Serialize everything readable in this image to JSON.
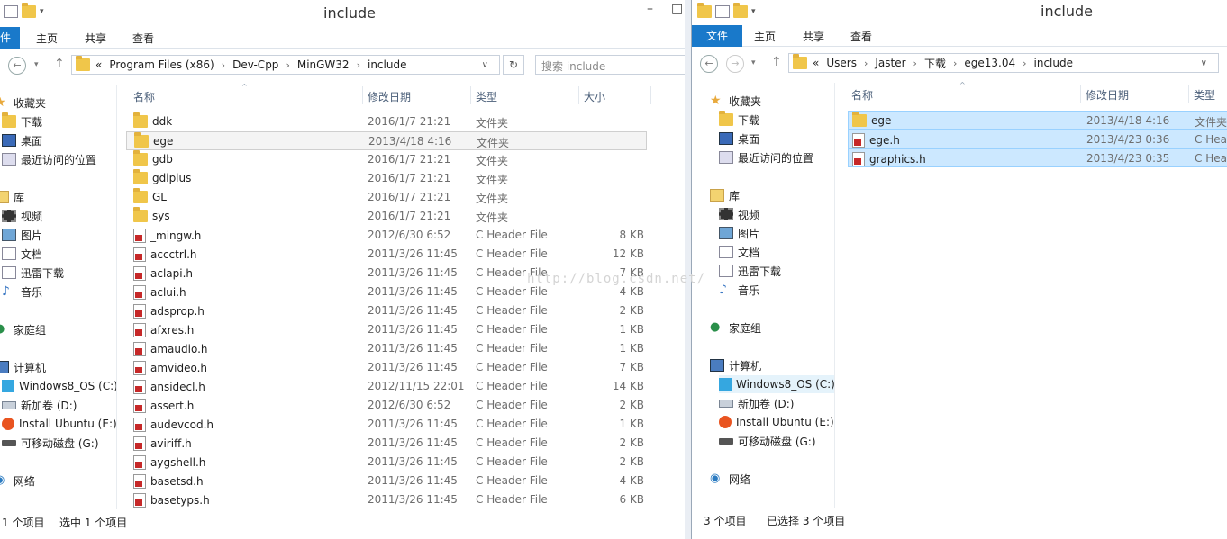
{
  "left": {
    "title": "include",
    "ribbon_tabs": [
      "件",
      "主页",
      "共享",
      "查看"
    ],
    "address": {
      "prefix": "«",
      "segments": [
        "Program Files (x86)",
        "Dev-Cpp",
        "MinGW32",
        "include"
      ]
    },
    "search_placeholder": "搜索 include",
    "nav": [
      {
        "label": "收藏夹",
        "icon": "favorites-star-icon",
        "icls": "star"
      },
      {
        "label": "下载",
        "icon": "downloads-folder-icon",
        "icls": "folder"
      },
      {
        "label": "桌面",
        "icon": "desktop-icon",
        "icls": "desk"
      },
      {
        "label": "最近访问的位置",
        "icon": "recent-places-icon",
        "icls": "recent"
      },
      {
        "label": "库",
        "icon": "libraries-icon",
        "icls": "lib"
      },
      {
        "label": "视频",
        "icon": "videos-icon",
        "icls": "video"
      },
      {
        "label": "图片",
        "icon": "pictures-icon",
        "icls": "pic"
      },
      {
        "label": "文档",
        "icon": "documents-icon",
        "icls": "doc"
      },
      {
        "label": "迅雷下载",
        "icon": "thunder-download-icon",
        "icls": "doc"
      },
      {
        "label": "音乐",
        "icon": "music-icon",
        "icls": "music"
      },
      {
        "label": "家庭组",
        "icon": "homegroup-icon",
        "icls": "home"
      },
      {
        "label": "计算机",
        "icon": "computer-icon",
        "icls": "pc"
      },
      {
        "label": "Windows8_OS (C:)",
        "icon": "windows-drive-icon",
        "icls": "win8"
      },
      {
        "label": "新加卷 (D:)",
        "icon": "drive-icon",
        "icls": "drv"
      },
      {
        "label": "Install Ubuntu (E:)",
        "icon": "ubuntu-drive-icon",
        "icls": "ubuntu"
      },
      {
        "label": "可移动磁盘 (G:)",
        "icon": "removable-drive-icon",
        "icls": "usb"
      },
      {
        "label": "网络",
        "icon": "network-icon",
        "icls": "net"
      }
    ],
    "columns": {
      "name": "名称",
      "date": "修改日期",
      "type": "类型",
      "size": "大小"
    },
    "files": [
      {
        "name": "ddk",
        "date": "2016/1/7 21:21",
        "type": "文件夹",
        "size": "",
        "kind": "folder"
      },
      {
        "name": "ege",
        "date": "2013/4/18 4:16",
        "type": "文件夹",
        "size": "",
        "kind": "folder"
      },
      {
        "name": "gdb",
        "date": "2016/1/7 21:21",
        "type": "文件夹",
        "size": "",
        "kind": "folder"
      },
      {
        "name": "gdiplus",
        "date": "2016/1/7 21:21",
        "type": "文件夹",
        "size": "",
        "kind": "folder"
      },
      {
        "name": "GL",
        "date": "2016/1/7 21:21",
        "type": "文件夹",
        "size": "",
        "kind": "folder"
      },
      {
        "name": "sys",
        "date": "2016/1/7 21:21",
        "type": "文件夹",
        "size": "",
        "kind": "folder"
      },
      {
        "name": "_mingw.h",
        "date": "2012/6/30 6:52",
        "type": "C Header File",
        "size": "8 KB",
        "kind": "hfile"
      },
      {
        "name": "accctrl.h",
        "date": "2011/3/26 11:45",
        "type": "C Header File",
        "size": "12 KB",
        "kind": "hfile"
      },
      {
        "name": "aclapi.h",
        "date": "2011/3/26 11:45",
        "type": "C Header File",
        "size": "7 KB",
        "kind": "hfile"
      },
      {
        "name": "aclui.h",
        "date": "2011/3/26 11:45",
        "type": "C Header File",
        "size": "4 KB",
        "kind": "hfile"
      },
      {
        "name": "adsprop.h",
        "date": "2011/3/26 11:45",
        "type": "C Header File",
        "size": "2 KB",
        "kind": "hfile"
      },
      {
        "name": "afxres.h",
        "date": "2011/3/26 11:45",
        "type": "C Header File",
        "size": "1 KB",
        "kind": "hfile"
      },
      {
        "name": "amaudio.h",
        "date": "2011/3/26 11:45",
        "type": "C Header File",
        "size": "1 KB",
        "kind": "hfile"
      },
      {
        "name": "amvideo.h",
        "date": "2011/3/26 11:45",
        "type": "C Header File",
        "size": "7 KB",
        "kind": "hfile"
      },
      {
        "name": "ansidecl.h",
        "date": "2012/11/15 22:01",
        "type": "C Header File",
        "size": "14 KB",
        "kind": "hfile"
      },
      {
        "name": "assert.h",
        "date": "2012/6/30 6:52",
        "type": "C Header File",
        "size": "2 KB",
        "kind": "hfile"
      },
      {
        "name": "audevcod.h",
        "date": "2011/3/26 11:45",
        "type": "C Header File",
        "size": "1 KB",
        "kind": "hfile"
      },
      {
        "name": "aviriff.h",
        "date": "2011/3/26 11:45",
        "type": "C Header File",
        "size": "2 KB",
        "kind": "hfile"
      },
      {
        "name": "aygshell.h",
        "date": "2011/3/26 11:45",
        "type": "C Header File",
        "size": "2 KB",
        "kind": "hfile"
      },
      {
        "name": "basetsd.h",
        "date": "2011/3/26 11:45",
        "type": "C Header File",
        "size": "4 KB",
        "kind": "hfile"
      },
      {
        "name": "basetyps.h",
        "date": "2011/3/26 11:45",
        "type": "C Header File",
        "size": "6 KB",
        "kind": "hfile"
      }
    ],
    "selected_index": 1,
    "status": {
      "count": "1 个项目",
      "selected": "选中 1 个项目"
    }
  },
  "right": {
    "title": "include",
    "ribbon_tabs": [
      "文件",
      "主页",
      "共享",
      "查看"
    ],
    "address": {
      "prefix": "«",
      "segments": [
        "Users",
        "Jaster",
        "下载",
        "ege13.04",
        "include"
      ]
    },
    "nav": [
      {
        "label": "收藏夹",
        "icon": "favorites-star-icon",
        "icls": "star"
      },
      {
        "label": "下载",
        "icon": "downloads-folder-icon",
        "icls": "folder"
      },
      {
        "label": "桌面",
        "icon": "desktop-icon",
        "icls": "desk"
      },
      {
        "label": "最近访问的位置",
        "icon": "recent-places-icon",
        "icls": "recent"
      },
      {
        "label": "库",
        "icon": "libraries-icon",
        "icls": "lib"
      },
      {
        "label": "视频",
        "icon": "videos-icon",
        "icls": "video"
      },
      {
        "label": "图片",
        "icon": "pictures-icon",
        "icls": "pic"
      },
      {
        "label": "文档",
        "icon": "documents-icon",
        "icls": "doc"
      },
      {
        "label": "迅雷下载",
        "icon": "thunder-download-icon",
        "icls": "doc"
      },
      {
        "label": "音乐",
        "icon": "music-icon",
        "icls": "music"
      },
      {
        "label": "家庭组",
        "icon": "homegroup-icon",
        "icls": "home"
      },
      {
        "label": "计算机",
        "icon": "computer-icon",
        "icls": "pc"
      },
      {
        "label": "Windows8_OS (C:)",
        "icon": "windows-drive-icon",
        "icls": "win8"
      },
      {
        "label": "新加卷 (D:)",
        "icon": "drive-icon",
        "icls": "drv"
      },
      {
        "label": "Install Ubuntu (E:)",
        "icon": "ubuntu-drive-icon",
        "icls": "ubuntu"
      },
      {
        "label": "可移动磁盘 (G:)",
        "icon": "removable-drive-icon",
        "icls": "usb"
      },
      {
        "label": "网络",
        "icon": "network-icon",
        "icls": "net"
      }
    ],
    "nav_selected_index": 12,
    "columns": {
      "name": "名称",
      "date": "修改日期",
      "type": "类型"
    },
    "files": [
      {
        "name": "ege",
        "date": "2013/4/18 4:16",
        "type": "文件夹",
        "kind": "folder"
      },
      {
        "name": "ege.h",
        "date": "2013/4/23 0:36",
        "type": "C Head",
        "kind": "hfile"
      },
      {
        "name": "graphics.h",
        "date": "2013/4/23 0:35",
        "type": "C Head",
        "kind": "hfile"
      }
    ],
    "status": {
      "count": "3 个项目",
      "selected": "已选择 3 个项目"
    }
  },
  "watermark": "http://blog.csdn.net/"
}
